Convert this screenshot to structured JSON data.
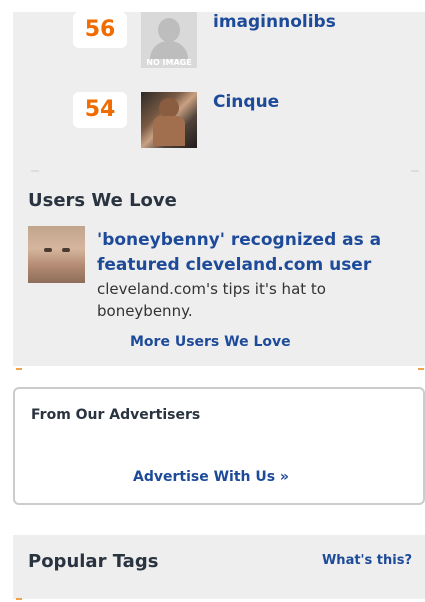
{
  "rankings": [
    {
      "rank": "56",
      "name": "imaginnolibs",
      "image_caption": "NO IMAGE"
    },
    {
      "rank": "54",
      "name": "Cinque",
      "image_caption": ""
    }
  ],
  "users_we_love": {
    "heading": "Users We Love",
    "feature_title": "'boneybenny' recognized as a featured cleveland.com user",
    "feature_desc": "cleveland.com's tips it's hat to boneybenny.",
    "more_link": "More Users We Love"
  },
  "advertisers": {
    "heading": "From Our Advertisers",
    "link": "Advertise With Us »"
  },
  "popular_tags": {
    "heading": "Popular Tags",
    "help_link": "What's this?"
  },
  "colors": {
    "link": "#1e4b99",
    "rank": "#f06b00",
    "panel": "#eeeeee"
  }
}
